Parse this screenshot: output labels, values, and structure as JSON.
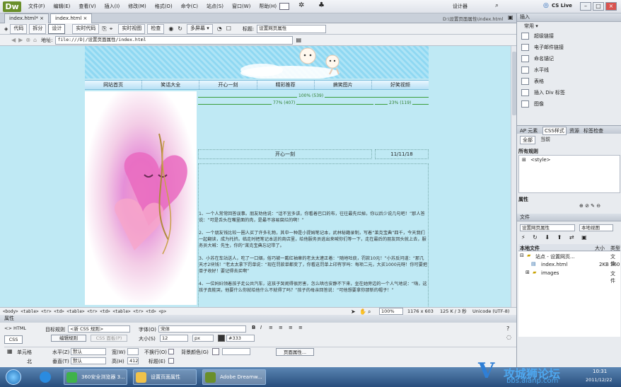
{
  "menubar": {
    "logo": "Dw",
    "items": [
      "文件(F)",
      "编辑(E)",
      "查看(V)",
      "插入(I)",
      "修改(M)",
      "格式(O)",
      "命令(C)",
      "站点(S)",
      "窗口(W)",
      "帮助(H)"
    ],
    "workspace": "设计器",
    "cslive": "CS Live"
  },
  "doctabs": {
    "tabs": [
      "index.html*",
      "index.html"
    ],
    "path": "D:\\设置页面属性\\index.html"
  },
  "toolbar": {
    "buttons": [
      "代码",
      "拆分",
      "设计",
      "实时代码",
      "实时视图",
      "检查",
      "多屏幕"
    ],
    "title_label": "标题:",
    "title_value": "设置网页属性"
  },
  "address": {
    "label": "地址:",
    "value": "file:///D|/设置页面属性/index.html"
  },
  "page": {
    "nav": [
      "网站首页",
      "笑话大全",
      "开心一刻",
      "精彩推荐",
      "搞笑图片",
      "好笑视频"
    ],
    "width_main": "77% (407)",
    "width_total": "100% (539)",
    "width_side": "23% (119)",
    "content_title": "开心一刻",
    "content_date": "11/11/18",
    "paragraphs": [
      "1、一个人常常回答误事。朋友劝他说：“话不宜多讲，你看着巴口的布，往往最先烂掉。你以后少说几句吧！”那人答说：“可是舌头在嘴里面的肉，是最不容易腐烂的啊！”",
      "2、一个朋友钱比较一圈人买了许多礼物，其中一种是小提姆笔记本，武林秘籍录制，写着“莱克宝典”四千，今天我们一起翻读，成为托挤。临走时把笔记本送的商店里，给他服务员逃出来喊你们等一下，走在最后的朋友回头就上去，服务员大喊：先生，你的“莱克宝典忘记带了。",
      "3、小苏在车站送人，吃了一口烟，俗巧被一戴红袖章的老太太逮正着：“随地吐痰，罚款10元！”小苏反问道：“那几天才2块钱！”老太太拿下罚单说：“现在罚款单都变了，你看这罚单上印有字吗：每项二元，大买1000元呀！你可要把单子收好！要记得去买啊”",
      "4、一位妈妇领着孩子走公共汽车，这孩子哭闹得很厉害，怎么哄也安静不下来，坐在她旁边的一个人气地说：“嗨，这孩子真能哭，他要什么你就给他什么不就得了吗？”孩子的母亲回答说：“可他想要拿你那新的帽子！”"
    ]
  },
  "tagbar": {
    "tags": "<body> <table> <tr> <td> <table> <tr> <td> <table> <tr> <td> <p>",
    "zoom": "100%",
    "size": "1176 x 603",
    "weight": "125 K / 3 秒",
    "encoding": "Unicode (UTF-8)"
  },
  "properties": {
    "title": "属性",
    "html_btn": "<> HTML",
    "css_btn": "CSS",
    "target_rule_label": "目标规则",
    "target_rule_value": "<新 CSS 规则>",
    "edit_rule_btn": "编辑规则",
    "css_panel_btn": "CSS 面板(P)",
    "font_label": "字体(O)",
    "font_value": "宋体",
    "size_label": "大小(S)",
    "size_value": "12",
    "unit_value": "px",
    "color_value": "#333",
    "cell_label": "单元格",
    "horz_label": "水平(Z)",
    "horz_value": "默认",
    "vert_label": "垂直(T)",
    "vert_value": "默认",
    "width_label": "宽(W)",
    "height_label": "高(H)",
    "height_value": "412",
    "nowrap_label": "不换行(O)",
    "header_label": "标题(E)",
    "bg_label": "背景颜色(G)",
    "page_props_btn": "页面属性...",
    "merge_label": "北"
  },
  "right_panel": {
    "insert_tab": "插入",
    "category": "常用",
    "insert_items": [
      "超级链接",
      "电子邮件链接",
      "命名锚记",
      "水平线",
      "表格",
      "插入 Div 标签",
      "图像"
    ],
    "css_tabs": [
      "AP 元素",
      "CSS样式",
      "资源",
      "标签检查"
    ],
    "css_modes": [
      "全部",
      "当前"
    ],
    "all_rules_label": "所有规则",
    "rule_item": "<style>",
    "props_label": "属性",
    "files_tab": "文件",
    "site_select": "设置网页属性",
    "view_select": "本地视图",
    "col_local": "本地文件",
    "col_size": "大小",
    "col_type": "类型",
    "files": [
      {
        "name": "站点 - 设置网页...",
        "size": "",
        "type": "文件"
      },
      {
        "name": "index.html",
        "size": "2KB",
        "type": "360"
      },
      {
        "name": "images",
        "size": "",
        "type": "文件"
      }
    ]
  },
  "taskbar": {
    "tasks": [
      "360安全浏览器 3...",
      "设置页面属性",
      "Adobe Dreamw..."
    ],
    "time": "10:31",
    "date": "2011/12/22",
    "watermark": "攻城狮论坛",
    "watermark_url": "bbs.aianp.com"
  }
}
